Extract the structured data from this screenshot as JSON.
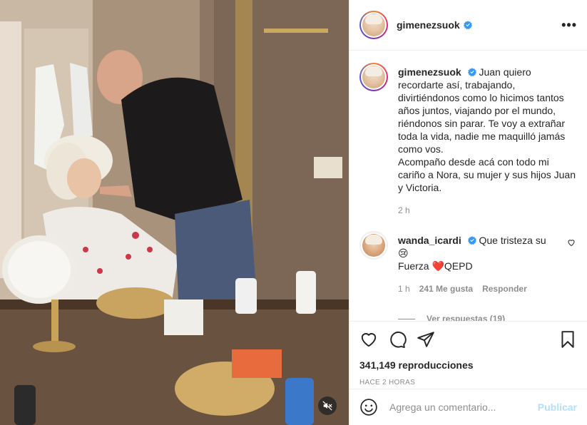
{
  "post": {
    "username": "gimenezsuok",
    "more_label": "•••",
    "caption": "Juan quiero recordarte así, trabajando, divirtiéndonos como lo hicimos tantos años juntos, viajando por el mundo, riéndonos sin parar. Te voy a extrañar toda la vida, nadie me maquilló jamás como vos.\nAcompaño desde acá con todo mi cariño a Nora, su mujer y sus hijos Juan y Victoria.",
    "caption_time": "2 h"
  },
  "comments": [
    {
      "username": "wanda_icardi",
      "text_part1": "Que tristeza su ",
      "emoji1": "😢",
      "text_part2": "Fuerza ",
      "emoji2": "❤️",
      "text_part3": "QEPD",
      "time": "1 h",
      "likes": "241 Me gusta",
      "reply_label": "Responder",
      "view_replies": "Ver respuestas (19)"
    }
  ],
  "stats": {
    "views": "341,149 reproducciones",
    "posted": "HACE 2 HORAS"
  },
  "composer": {
    "placeholder": "Agrega un comentario...",
    "post_label": "Publicar"
  },
  "icons": {
    "like": "heart-icon",
    "comment": "comment-icon",
    "share": "share-icon",
    "save": "bookmark-icon",
    "emoji": "smiley-icon",
    "mute": "muted-speaker-icon",
    "verified": "verified-badge-icon"
  },
  "colors": {
    "verified": "#3897f0",
    "post_disabled": "#b2dffc",
    "muted_text": "#8e8e8e"
  }
}
